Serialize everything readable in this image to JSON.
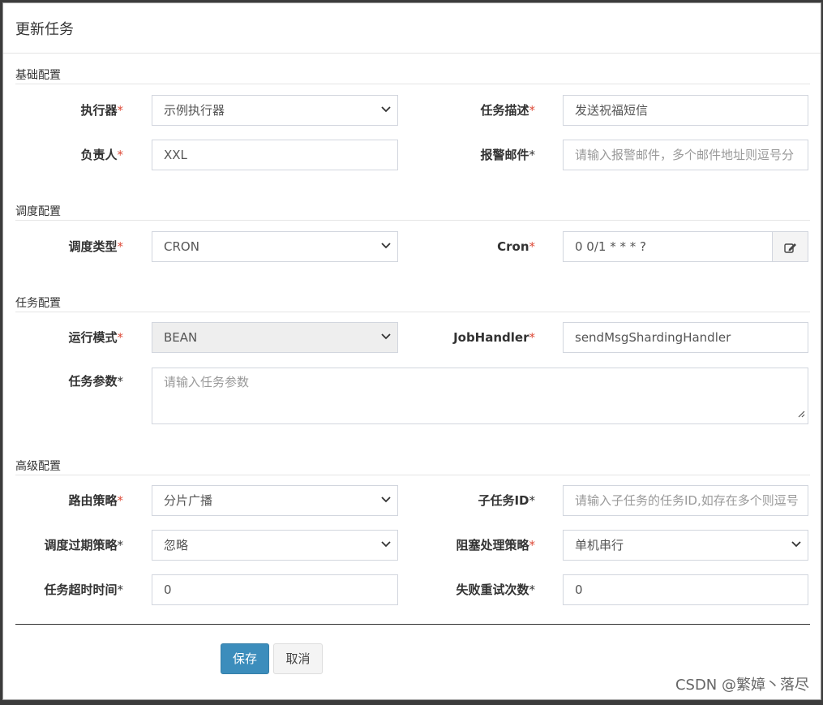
{
  "modal": {
    "title": "更新任务"
  },
  "sections": {
    "basic": "基础配置",
    "schedule": "调度配置",
    "task": "任务配置",
    "advanced": "高级配置"
  },
  "fields": {
    "executor": {
      "label": "执行器",
      "required_mark": "*",
      "value": "示例执行器"
    },
    "job_desc": {
      "label": "任务描述",
      "required_mark": "*",
      "value": "发送祝福短信"
    },
    "author": {
      "label": "负责人",
      "required_mark": "*",
      "value": "XXL"
    },
    "alarm_email": {
      "label": "报警邮件",
      "required_mark": "*",
      "placeholder": "请输入报警邮件，多个邮件地址则逗号分"
    },
    "schedule_type": {
      "label": "调度类型",
      "required_mark": "*",
      "value": "CRON"
    },
    "cron": {
      "label": "Cron",
      "required_mark": "*",
      "value": "0 0/1 * * * ?"
    },
    "glue_type": {
      "label": "运行模式",
      "required_mark": "*",
      "value": "BEAN"
    },
    "job_handler": {
      "label": "JobHandler",
      "required_mark": "*",
      "value": "sendMsgShardingHandler"
    },
    "job_param": {
      "label": "任务参数",
      "required_mark": "*",
      "placeholder": "请输入任务参数"
    },
    "route_strategy": {
      "label": "路由策略",
      "required_mark": "*",
      "value": "分片广播"
    },
    "child_job_id": {
      "label": "子任务ID",
      "required_mark": "*",
      "placeholder": "请输入子任务的任务ID,如存在多个则逗号"
    },
    "misfire_strategy": {
      "label": "调度过期策略",
      "required_mark": "*",
      "value": "忽略"
    },
    "block_strategy": {
      "label": "阻塞处理策略",
      "required_mark": "*",
      "value": "单机串行"
    },
    "timeout": {
      "label": "任务超时时间",
      "required_mark": "*",
      "value": "0"
    },
    "fail_retry": {
      "label": "失败重试次数",
      "required_mark": "*",
      "value": "0"
    }
  },
  "buttons": {
    "save": "保存",
    "cancel": "取消"
  },
  "watermark": "CSDN @繁嫜丶落尽",
  "icons": {
    "cron_edit": "edit-icon",
    "select_caret": "chevron-down-icon"
  },
  "colors": {
    "primary": "#3c8dbc",
    "required": "#dd4b39"
  }
}
